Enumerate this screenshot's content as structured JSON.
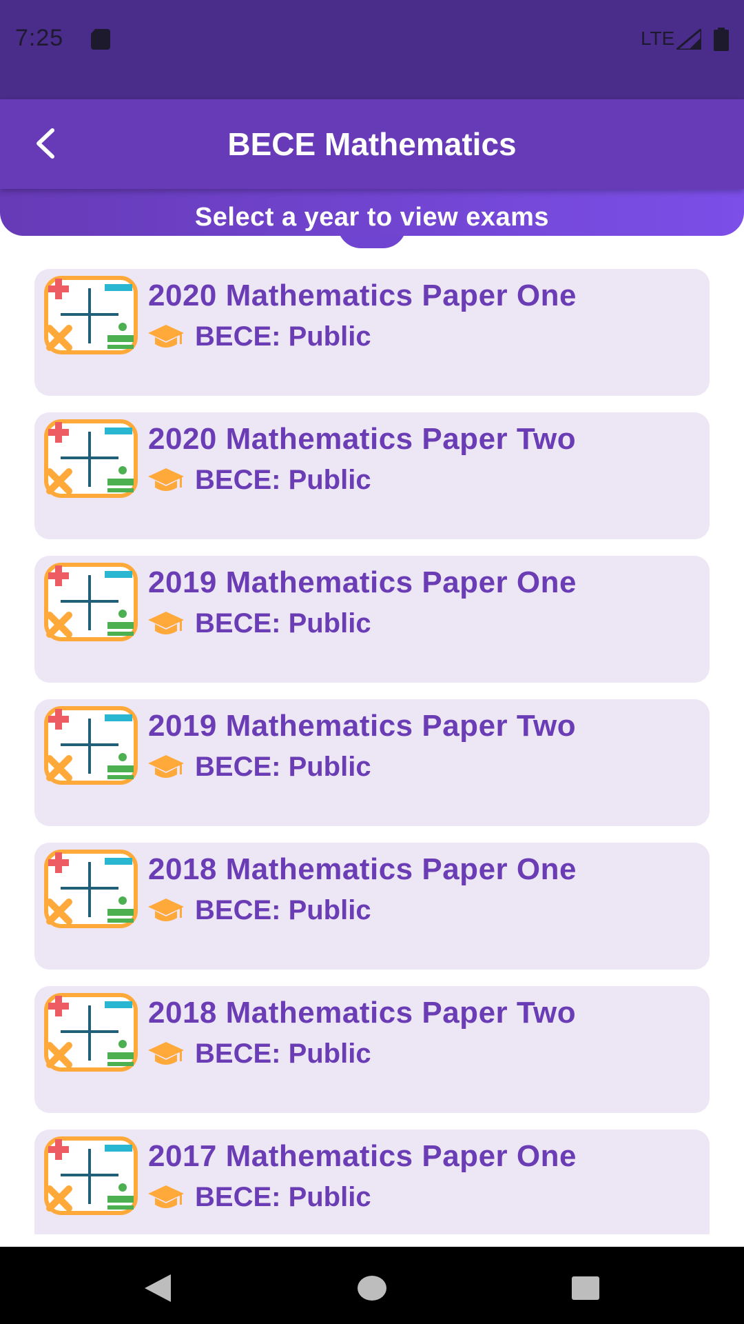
{
  "status_bar": {
    "time": "7:25",
    "network": "LTE",
    "icons": [
      "sd-card-icon",
      "signal-icon",
      "battery-icon"
    ]
  },
  "app_bar": {
    "title": "BECE Mathematics",
    "back_icon": "chevron-left-icon"
  },
  "banner": {
    "text": "Select a year to view exams"
  },
  "exams": [
    {
      "title": "2020 Mathematics Paper One",
      "subtitle": "BECE: Public"
    },
    {
      "title": "2020 Mathematics Paper Two",
      "subtitle": "BECE: Public"
    },
    {
      "title": "2019 Mathematics Paper One",
      "subtitle": "BECE: Public"
    },
    {
      "title": "2019 Mathematics Paper Two",
      "subtitle": "BECE: Public"
    },
    {
      "title": "2018 Mathematics Paper One",
      "subtitle": "BECE: Public"
    },
    {
      "title": "2018 Mathematics Paper Two",
      "subtitle": "BECE: Public"
    },
    {
      "title": "2017 Mathematics Paper One",
      "subtitle": "BECE: Public"
    }
  ],
  "nav_bar": {
    "icons": [
      "nav-back-icon",
      "nav-home-icon",
      "nav-recents-icon"
    ]
  },
  "colors": {
    "status_bar": "#4a2c8a",
    "app_bar": "#673ab7",
    "card_bg": "#ede6f5",
    "card_text": "#6a3db5",
    "accent_orange": "#ffa93a"
  }
}
